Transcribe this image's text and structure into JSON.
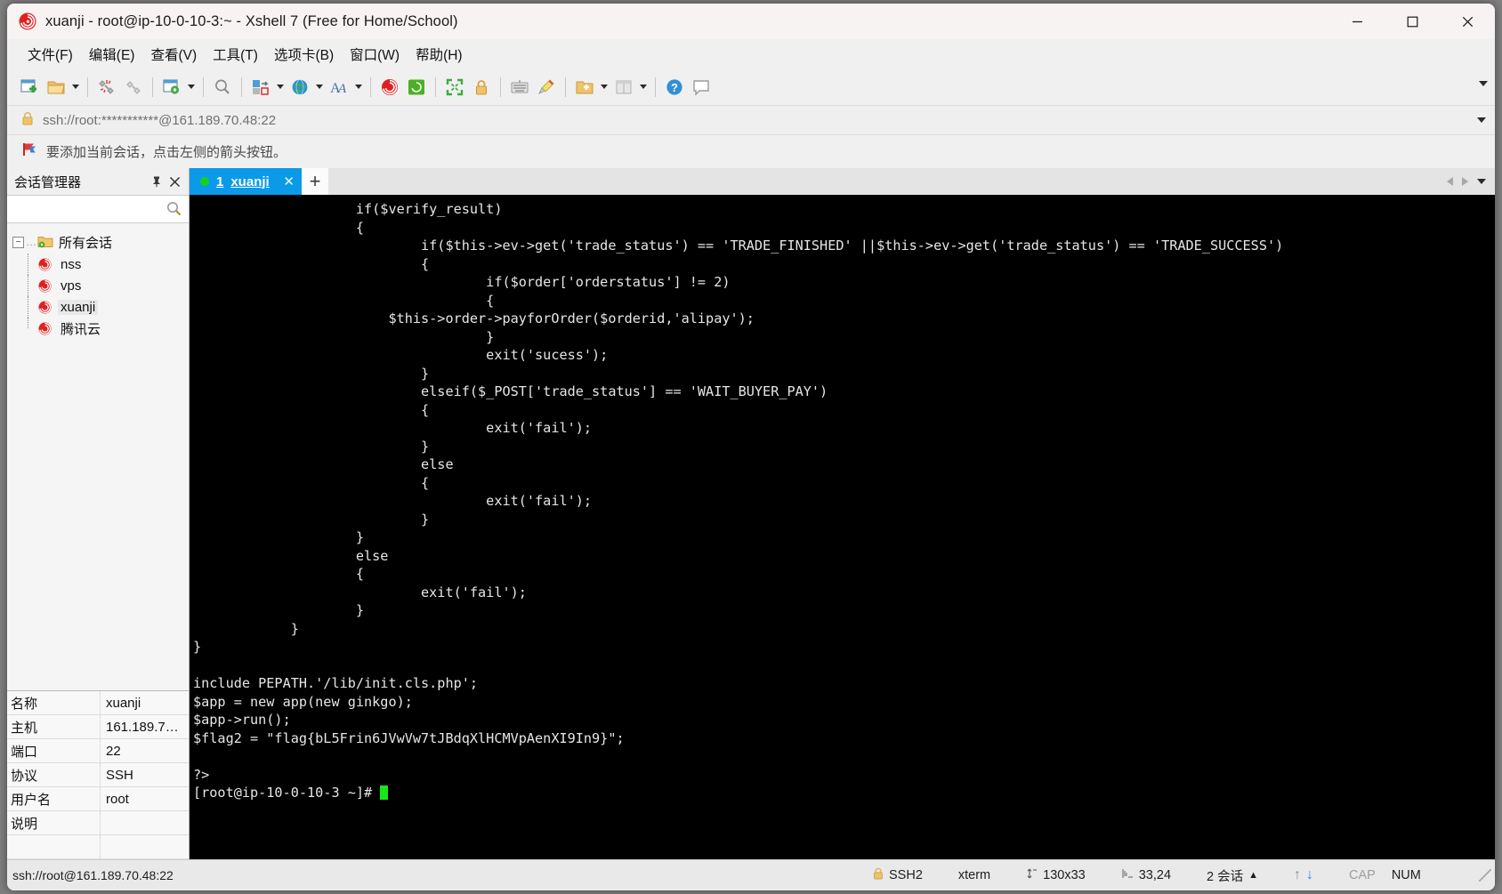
{
  "window": {
    "title": "xuanji - root@ip-10-0-10-3:~ - Xshell 7 (Free for Home/School)",
    "app_icon": "xshell-logo-icon",
    "minimize_label": "—",
    "maximize_label": "□",
    "close_label": "✕"
  },
  "menubar": {
    "items": [
      {
        "label": "文件(F)"
      },
      {
        "label": "编辑(E)"
      },
      {
        "label": "查看(V)"
      },
      {
        "label": "工具(T)"
      },
      {
        "label": "选项卡(B)"
      },
      {
        "label": "窗口(W)"
      },
      {
        "label": "帮助(H)"
      }
    ]
  },
  "toolbar": {
    "buttons": [
      {
        "name": "new-session-icon",
        "has_arrow": false
      },
      {
        "name": "open-folder-icon",
        "has_arrow": true
      },
      {
        "name": "disconnect-icon",
        "has_arrow": false
      },
      {
        "name": "reconnect-icon",
        "has_arrow": false
      },
      {
        "name": "session-properties-icon",
        "has_arrow": true
      },
      {
        "name": "find-icon",
        "has_arrow": false
      },
      {
        "name": "transfer-icon",
        "has_arrow": true
      },
      {
        "name": "globe-icon",
        "has_arrow": true
      },
      {
        "name": "font-icon",
        "has_arrow": true
      },
      {
        "name": "xshell-icon",
        "has_arrow": false
      },
      {
        "name": "xftp-icon",
        "has_arrow": false
      },
      {
        "name": "fullscreen-icon",
        "has_arrow": false
      },
      {
        "name": "lock-icon",
        "has_arrow": false
      },
      {
        "name": "keyboard-icon",
        "has_arrow": false
      },
      {
        "name": "highlight-icon",
        "has_arrow": false
      },
      {
        "name": "add-folder-icon",
        "has_arrow": true
      },
      {
        "name": "layout-icon",
        "has_arrow": true
      },
      {
        "name": "help-icon",
        "has_arrow": false
      },
      {
        "name": "feedback-icon",
        "has_arrow": false
      }
    ],
    "overflow_icon": "toolbar-overflow-chevron-icon"
  },
  "address_bar": {
    "lock_icon": "lock-icon",
    "url": "ssh://root:***********@161.189.70.48:22",
    "dropdown_icon": "chevron-down-icon"
  },
  "notice_bar": {
    "icon": "red-flag-icon",
    "text": "要添加当前会话，点击左侧的箭头按钮。"
  },
  "sidebar": {
    "title": "会话管理器",
    "pin_icon": "pin-icon",
    "close_icon": "close-icon",
    "search": {
      "value": "",
      "placeholder": "",
      "icon": "search-icon"
    },
    "tree": {
      "root": {
        "label": "所有会话",
        "icon": "folder-gear-icon",
        "expanded": true,
        "toggle": "−"
      },
      "children": [
        {
          "label": "nss",
          "icon": "xshell-session-icon",
          "selected": false
        },
        {
          "label": "vps",
          "icon": "xshell-session-icon",
          "selected": false
        },
        {
          "label": "xuanji",
          "icon": "xshell-session-icon",
          "selected": true
        },
        {
          "label": "腾讯云",
          "icon": "xshell-session-icon",
          "selected": false
        }
      ]
    },
    "properties": [
      {
        "key": "名称",
        "value": "xuanji"
      },
      {
        "key": "主机",
        "value": "161.189.7…"
      },
      {
        "key": "端口",
        "value": "22"
      },
      {
        "key": "协议",
        "value": "SSH"
      },
      {
        "key": "用户名",
        "value": "root"
      },
      {
        "key": "说明",
        "value": ""
      },
      {
        "key": "",
        "value": ""
      }
    ]
  },
  "tabs": {
    "items": [
      {
        "index": "1",
        "label": "xuanji",
        "status_dot": "#18d018",
        "close_label": "✕",
        "active": true
      }
    ],
    "new_tab_label": "+",
    "nav_prev_icon": "chevron-left-icon",
    "nav_next_icon": "chevron-right-icon",
    "nav_list_icon": "chevron-down-icon"
  },
  "terminal": {
    "lines": [
      "                    if($verify_result)",
      "                    {",
      "                            if($this->ev->get('trade_status') == 'TRADE_FINISHED' ||$this->ev->get('trade_status') == 'TRADE_SUCCESS')",
      "                            {",
      "                                    if($order['orderstatus'] != 2)",
      "                                    {",
      "                        $this->order->payforOrder($orderid,'alipay');",
      "                                    }",
      "                                    exit('sucess');",
      "                            }",
      "                            elseif($_POST['trade_status'] == 'WAIT_BUYER_PAY')",
      "                            {",
      "                                    exit('fail');",
      "                            }",
      "                            else",
      "                            {",
      "                                    exit('fail');",
      "                            }",
      "                    }",
      "                    else",
      "                    {",
      "                            exit('fail');",
      "                    }",
      "            }",
      "}",
      "",
      "include PEPATH.'/lib/init.cls.php';",
      "$app = new app(new ginkgo);",
      "$app->run();",
      "$flag2 = \"flag{bL5Frin6JVwVw7tJBdqXlHCMVpAenXI9In9}\";",
      "",
      "?>"
    ],
    "prompt": "[root@ip-10-0-10-3 ~]# ",
    "cursor_color": "#17e617",
    "background": "#000000",
    "foreground": "#e6e6e6"
  },
  "statusbar": {
    "connection_url": "ssh://root@161.189.70.48:22",
    "security_icon": "lock-icon",
    "protocol": "SSH2",
    "terminal_type": "xterm",
    "size_icon": "resize-icon",
    "size": "130x33",
    "cursor_icon": "cursor-position-icon",
    "cursor_position": "33,24",
    "sessions": "2 会话",
    "sessions_caret": "▲",
    "upload_icon": "arrow-up-icon",
    "download_icon": "arrow-down-icon",
    "caps": "CAP",
    "num": "NUM"
  }
}
